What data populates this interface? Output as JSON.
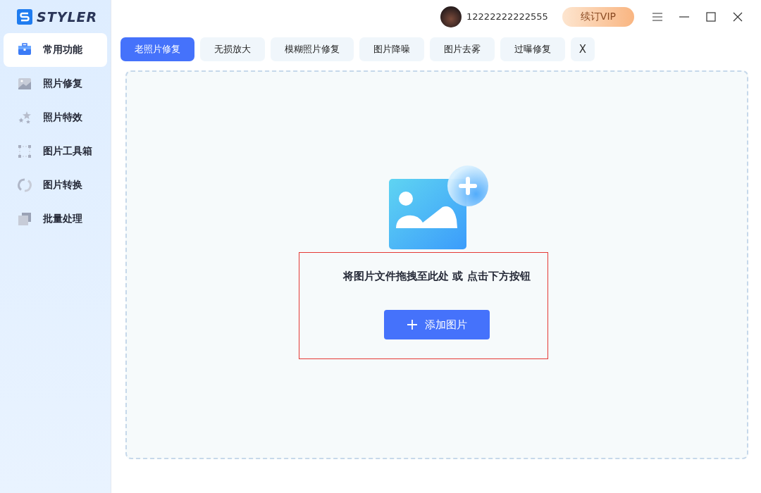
{
  "app": {
    "logo_text": "STYLER"
  },
  "sidebar": {
    "items": [
      {
        "label": "常用功能",
        "kind": "toolbox",
        "selected": true
      },
      {
        "label": "照片修复",
        "kind": "photo",
        "selected": false
      },
      {
        "label": "照片特效",
        "kind": "stars",
        "selected": false
      },
      {
        "label": "图片工具箱",
        "kind": "frame",
        "selected": false
      },
      {
        "label": "图片转换",
        "kind": "convert",
        "selected": false
      },
      {
        "label": "批量处理",
        "kind": "batch",
        "selected": false
      }
    ]
  },
  "header": {
    "username": "12222222222555",
    "vip_button": "续订VIP"
  },
  "tabs": [
    {
      "label": "老照片修复",
      "selected": true
    },
    {
      "label": "无损放大",
      "selected": false
    },
    {
      "label": "模糊照片修复",
      "selected": false
    },
    {
      "label": "图片降噪",
      "selected": false
    },
    {
      "label": "图片去雾",
      "selected": false
    },
    {
      "label": "过曝修复",
      "selected": false
    }
  ],
  "tabs_close": "X",
  "drop_zone": {
    "hint": "将图片文件拖拽至此处 或 点击下方按钮",
    "button": "添加图片"
  },
  "annotation": {
    "kind": "rectangle"
  }
}
